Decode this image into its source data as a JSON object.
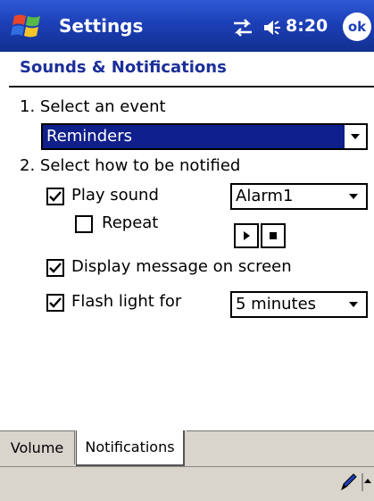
{
  "titlebar": {
    "app_title": "Settings",
    "clock": "8:20",
    "ok_label": "ok"
  },
  "page": {
    "heading": "Sounds & Notifications"
  },
  "step1": {
    "label": "1. Select an event",
    "selected_event": "Reminders"
  },
  "step2": {
    "label": "2. Select how to be notified",
    "play_sound": {
      "label": "Play sound",
      "checked": true
    },
    "repeat": {
      "label": "Repeat",
      "checked": false
    },
    "sound_select": "Alarm1",
    "display_message": {
      "label": "Display message on screen",
      "checked": true
    },
    "flash_light": {
      "label": "Flash light for",
      "checked": true
    },
    "flash_duration": "5 minutes"
  },
  "tabs": [
    {
      "label": "Volume",
      "active": false
    },
    {
      "label": "Notifications",
      "active": true
    }
  ],
  "icons": {
    "start": "windows-flag-icon",
    "connectivity": "connectivity-icon",
    "volume": "speaker-icon",
    "play": "play-icon",
    "stop": "stop-icon",
    "pen": "pen-icon",
    "input_panel": "input-panel-arrow-icon"
  },
  "colors": {
    "titlebar": "#1c3fb6",
    "heading": "#1c2f9a",
    "selection": "#0f1f8c",
    "bars": "#d9d4cc"
  }
}
